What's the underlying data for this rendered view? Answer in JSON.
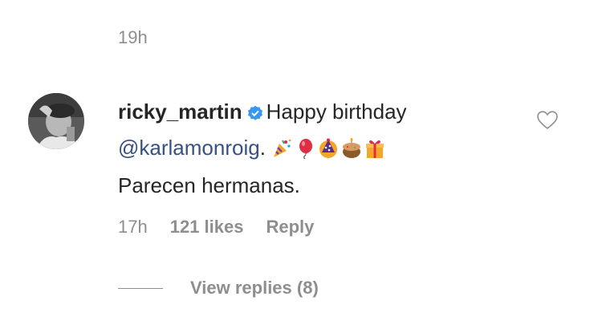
{
  "header": {
    "time": "19h"
  },
  "comment": {
    "username": "ricky_martin",
    "text": "Happy birthday",
    "mention": "@karlamonroig",
    "after_mention": ".",
    "emojis": [
      "party-popper",
      "balloon",
      "party-hat",
      "cake",
      "gift"
    ],
    "second_line": "Parecen hermanas.",
    "time": "17h",
    "likes": "121 likes",
    "reply_label": "Reply",
    "view_replies": "View replies (8)"
  },
  "colors": {
    "text": "#262626",
    "secondary": "#8e8e8e",
    "mention": "#385185",
    "verified": "#3897f0"
  }
}
